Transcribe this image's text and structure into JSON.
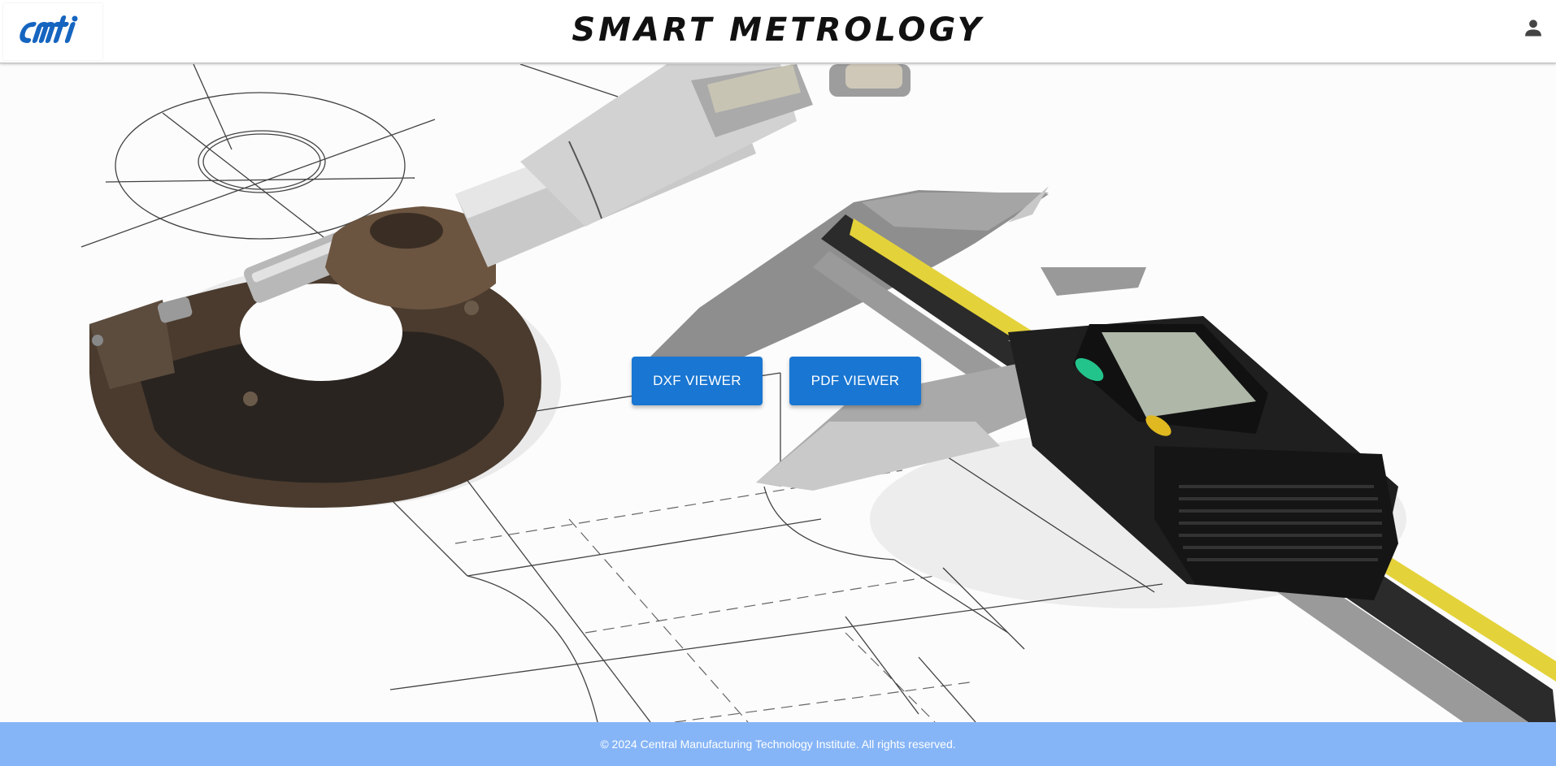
{
  "header": {
    "logo_text": "cmti",
    "title": "SMART METROLOGY",
    "user_icon": "account-icon"
  },
  "main": {
    "buttons": [
      {
        "label": "DXF VIEWER"
      },
      {
        "label": "PDF VIEWER"
      }
    ],
    "background": "metrology-tools-image"
  },
  "footer": {
    "text": "© 2024 Central Manufacturing Technology Institute. All rights reserved."
  },
  "colors": {
    "primary": "#1976d2",
    "footer_bg": "#86b5f7",
    "logo": "#1565c0"
  }
}
